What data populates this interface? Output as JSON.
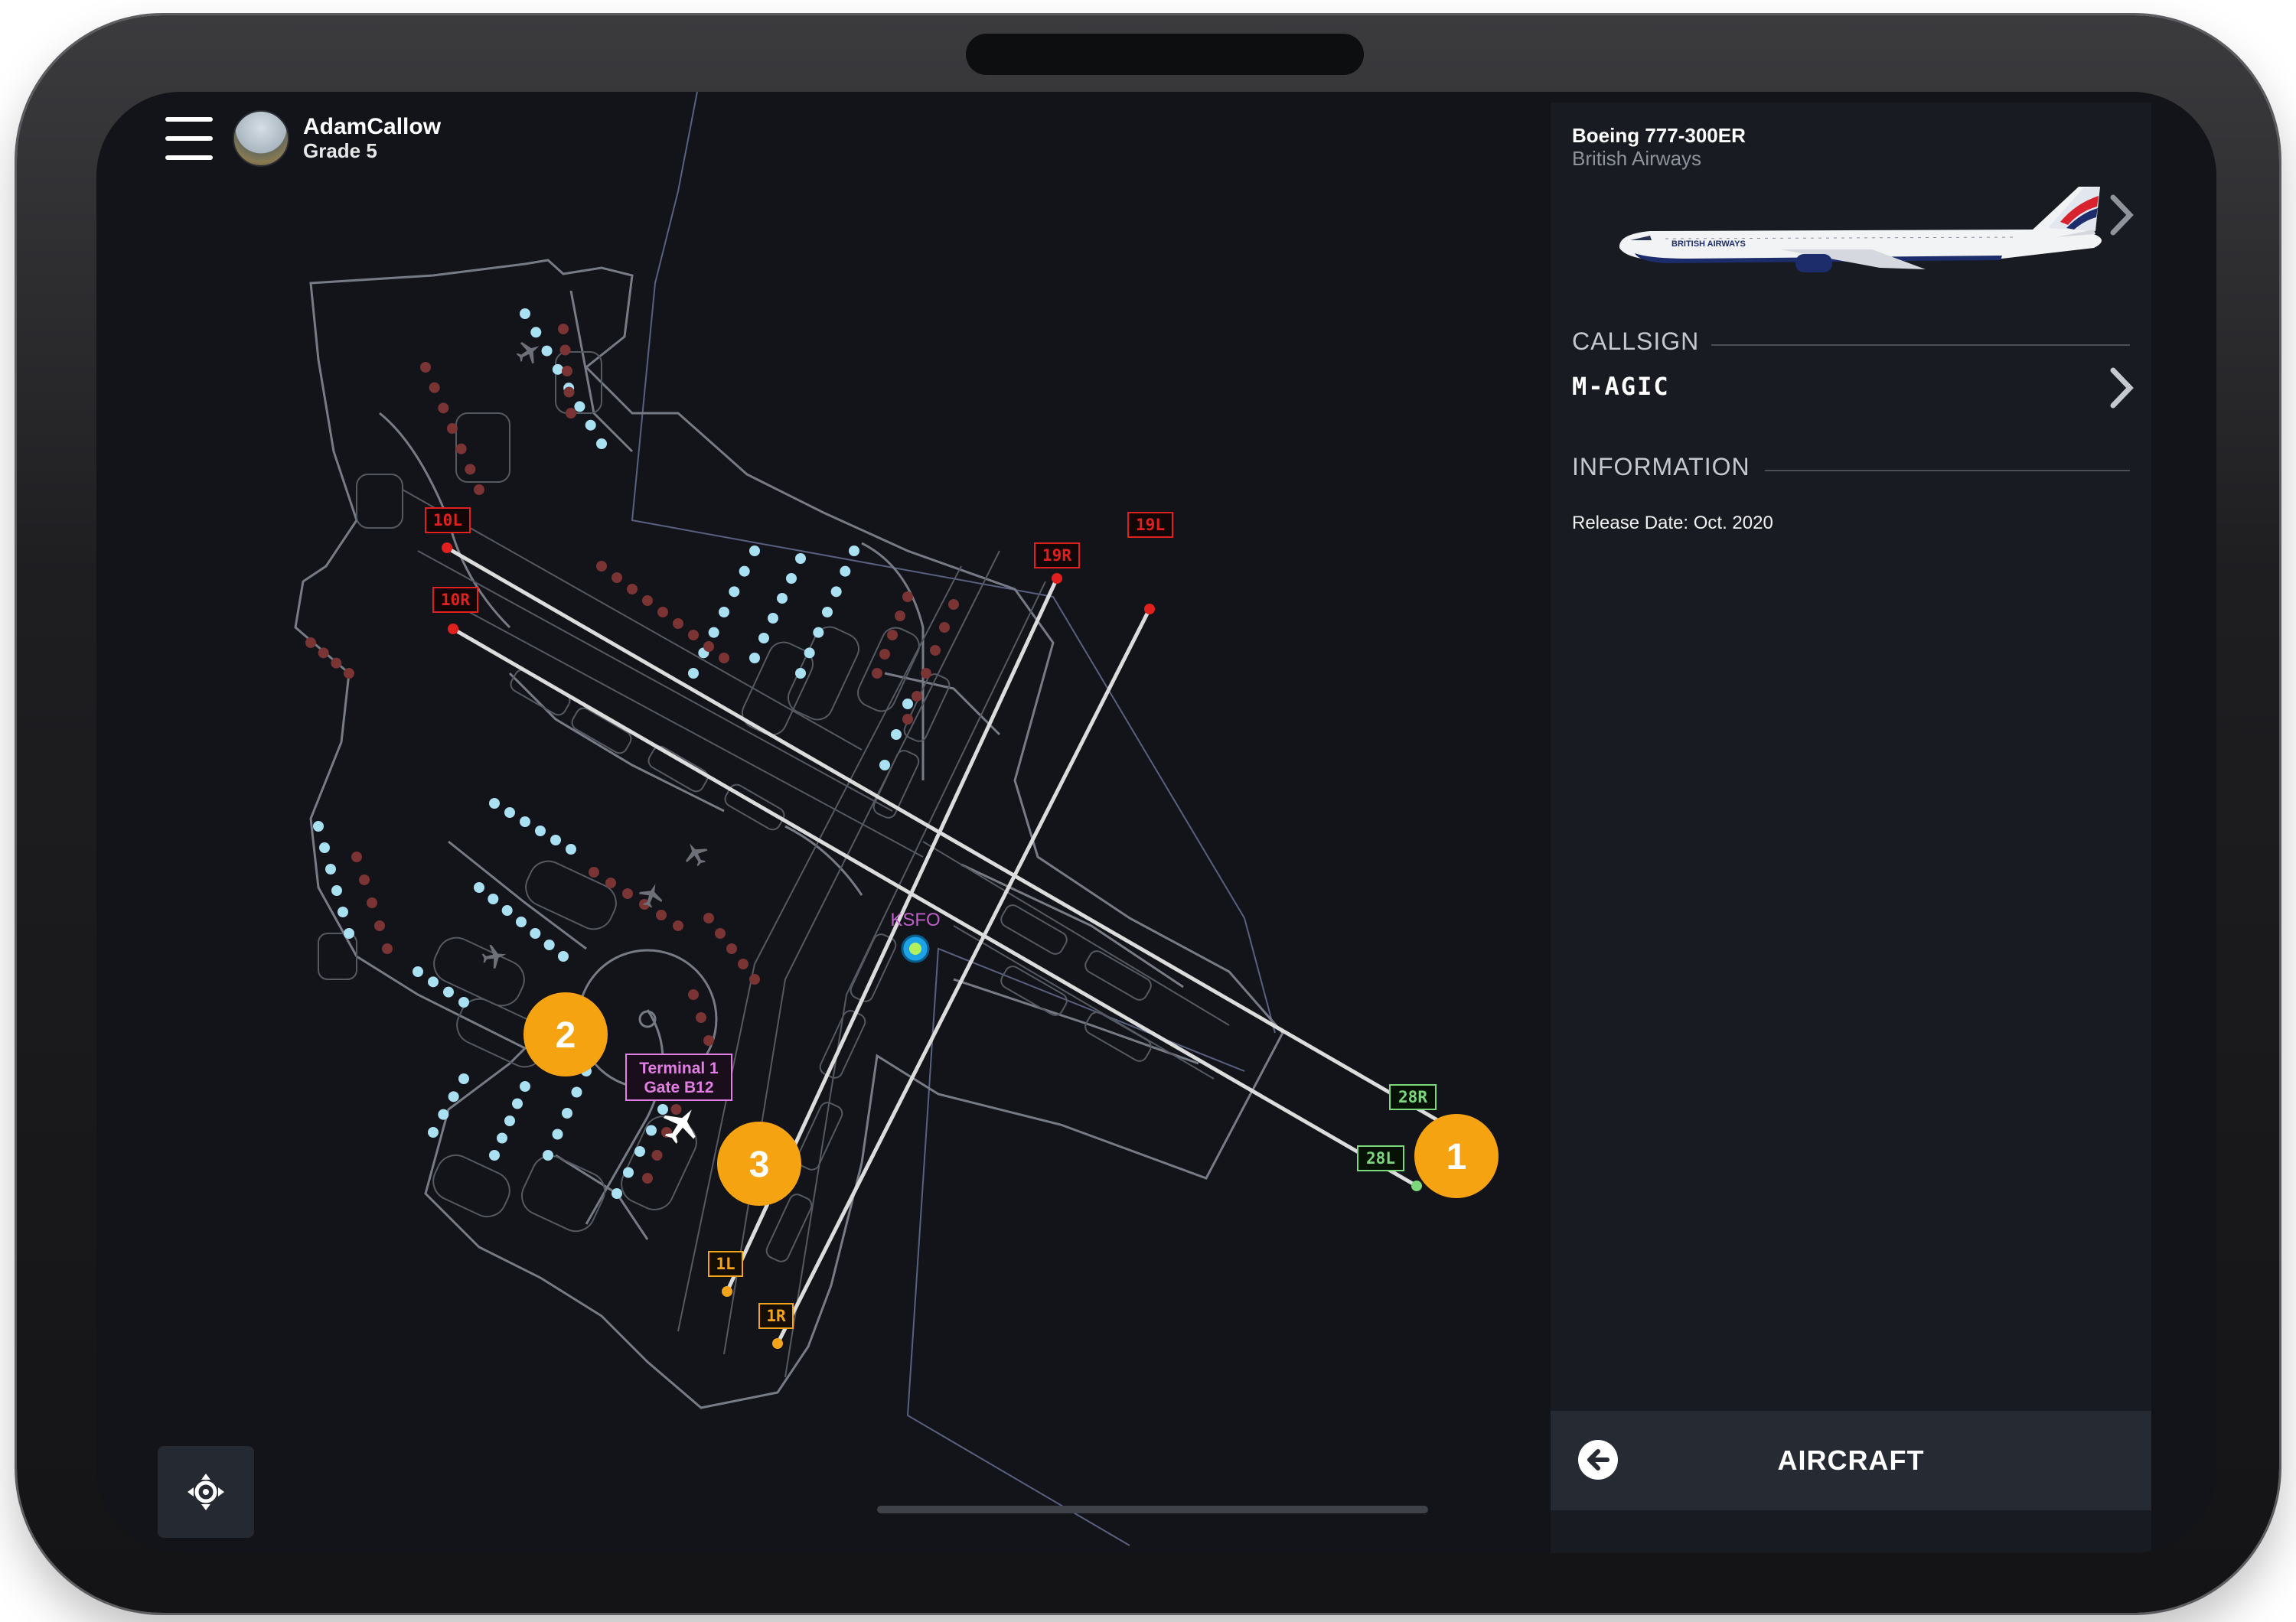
{
  "user": {
    "name": "AdamCallow",
    "grade": "Grade 5"
  },
  "aircraft": {
    "model": "Boeing 777-300ER",
    "airline": "British Airways",
    "livery_text": "BRITISH AIRWAYS"
  },
  "callsign": {
    "label": "CALLSIGN",
    "value": "M-AGIC"
  },
  "information": {
    "label": "INFORMATION",
    "release_date": "Release Date: Oct. 2020"
  },
  "bottom_bar": {
    "label": "AIRCRAFT"
  },
  "map": {
    "airport_code": "KSFO",
    "gate_label_line1": "Terminal 1",
    "gate_label_line2": "Gate B12",
    "runways": [
      "10L",
      "10R",
      "19R",
      "19L",
      "28R",
      "28L",
      "1L",
      "1R"
    ],
    "markers": [
      "1",
      "2",
      "3"
    ]
  },
  "colors": {
    "background": "#121419",
    "panel": "#181b21",
    "runway_red": "#e0201e",
    "runway_green": "#7dd87d",
    "runway_orange": "#f4a41a",
    "marker_orange": "#f6a312",
    "gate_label": "#e17fe2",
    "parking_dot": "#a9e0f2",
    "stand_dot": "#7a3434"
  }
}
